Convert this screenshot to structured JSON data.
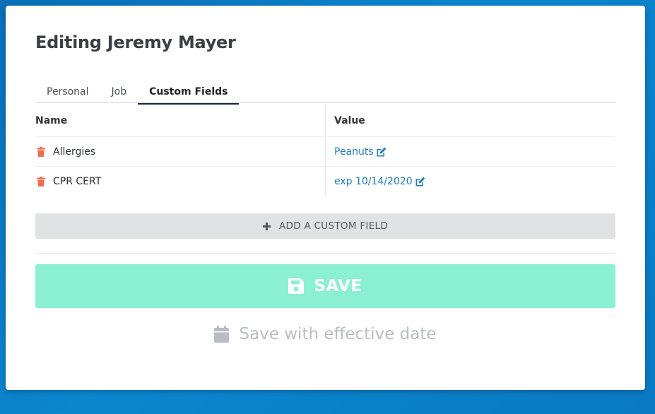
{
  "page": {
    "title": "Editing Jeremy Mayer"
  },
  "tabs": [
    {
      "label": "Personal",
      "active": false
    },
    {
      "label": "Job",
      "active": false
    },
    {
      "label": "Custom Fields",
      "active": true
    }
  ],
  "table": {
    "headers": {
      "name": "Name",
      "value": "Value"
    },
    "rows": [
      {
        "name": "Allergies",
        "value": "Peanuts"
      },
      {
        "name": "CPR CERT",
        "value": "exp 10/14/2020"
      }
    ]
  },
  "actions": {
    "add_custom_field": "ADD A CUSTOM FIELD",
    "save": "SAVE",
    "save_effective_date": "Save with effective date"
  },
  "colors": {
    "background": "#0b86cf",
    "accent_link": "#1d7cc7",
    "trash": "#f26b4f",
    "save_button": "#8bf0d2",
    "add_button": "#e1e2e4"
  },
  "icons": {
    "delete": "trash-icon",
    "edit": "edit-icon",
    "add": "plus-icon",
    "save": "floppy-disk-icon",
    "effective_date": "calendar-icon"
  }
}
